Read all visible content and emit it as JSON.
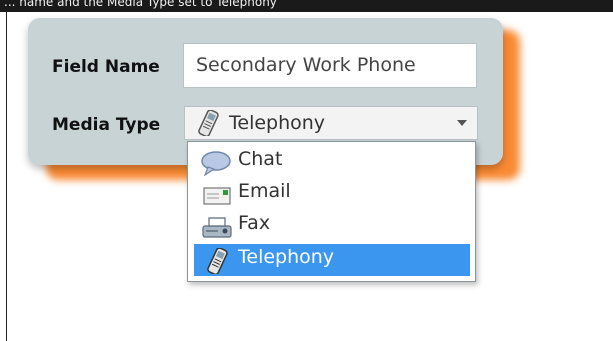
{
  "caption": "... name and the Media Type set to Telephony",
  "form": {
    "field_name_label": "Field Name",
    "field_name_value": "Secondary Work Phone",
    "media_type_label": "Media Type",
    "media_type_value": "Telephony",
    "media_type_icon": "telephony-icon"
  },
  "dropdown": {
    "options": [
      {
        "label": "Chat",
        "icon": "chat-icon",
        "selected": false
      },
      {
        "label": "Email",
        "icon": "email-icon",
        "selected": false
      },
      {
        "label": "Fax",
        "icon": "fax-icon",
        "selected": false
      },
      {
        "label": "Telephony",
        "icon": "telephony-icon",
        "selected": true
      }
    ]
  },
  "colors": {
    "panel_background": "#c8d3d6",
    "panel_glow": "#f98a34",
    "selected_highlight": "#3a96ee"
  }
}
